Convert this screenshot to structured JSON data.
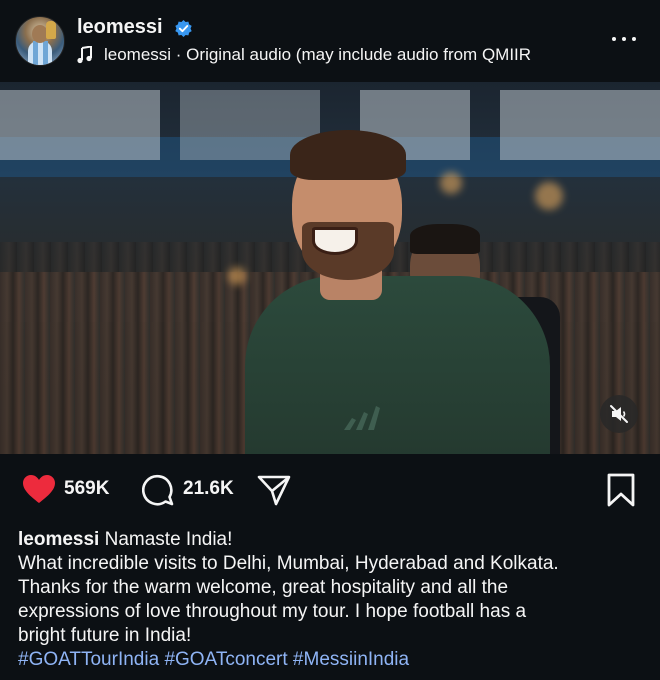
{
  "post": {
    "username": "leomessi",
    "verified": true,
    "audio": "leomessi · Original audio  (may include audio from QMIIR",
    "icons": {
      "avatar": "profile-avatar",
      "verified": "verified-badge-icon",
      "audio": "music-note-icon",
      "more": "more-options-icon",
      "mute": "muted-speaker-icon",
      "like": "heart-filled-icon",
      "comment": "comment-bubble-icon",
      "share": "send-arrow-icon",
      "save": "bookmark-icon"
    },
    "colors": {
      "background": "#0c1014",
      "like": "#ed2b3d",
      "verified": "#3897f0",
      "hashtag": "#8fb4f5"
    }
  },
  "actions": {
    "likes": "569K",
    "comments": "21.6K"
  },
  "caption": {
    "username": "leomessi",
    "first_line": " Namaste India!",
    "line1": "What incredible visits to Delhi, Mumbai, Hyderabad and Kolkata.",
    "line2": "Thanks for the warm welcome, great hospitality and all the",
    "line3": "expressions of love throughout my tour. I hope football has a",
    "line4": "bright future in India!",
    "hashtags": [
      "#GOATTourIndia",
      "#GOATconcert",
      "#MessiinIndia"
    ]
  }
}
